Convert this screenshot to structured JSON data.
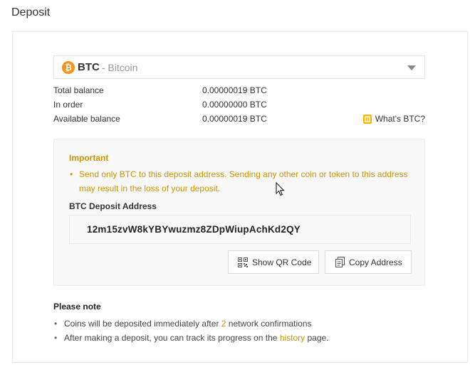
{
  "page": {
    "title": "Deposit"
  },
  "coin_selector": {
    "icon_glyph": "₿",
    "symbol": "BTC",
    "separator": " - ",
    "name": "Bitcoin"
  },
  "balances": [
    {
      "label": "Total balance",
      "value": "0.00000019 BTC"
    },
    {
      "label": "In order",
      "value": "0.00000000 BTC"
    },
    {
      "label": "Available balance",
      "value": "0.00000019 BTC"
    }
  ],
  "whats_link": {
    "icon": "book-icon",
    "label": "What's BTC?"
  },
  "important": {
    "title": "Important",
    "message_line1": "Send only BTC to this deposit address. Sending any other coin or token to this address",
    "message_line2": "may result in the loss of your deposit."
  },
  "deposit_address": {
    "label": "BTC Deposit Address",
    "value": "12m15zvW8kYBYwuzmz8ZDpWiupAchKd2QY"
  },
  "buttons": {
    "show_qr": "Show QR Code",
    "copy_address": "Copy Address"
  },
  "please_note": {
    "title": "Please note",
    "item1_prefix": "Coins will be deposited immediately after ",
    "item1_number": "2",
    "item1_suffix": " network confirmations",
    "item2_prefix": "After making a deposit, you can track its progress on the ",
    "item2_link": "history",
    "item2_suffix": " page."
  },
  "colors": {
    "accent": "#c99400",
    "btc_orange": "#f7931a",
    "info_yellow": "#f0b90b"
  }
}
